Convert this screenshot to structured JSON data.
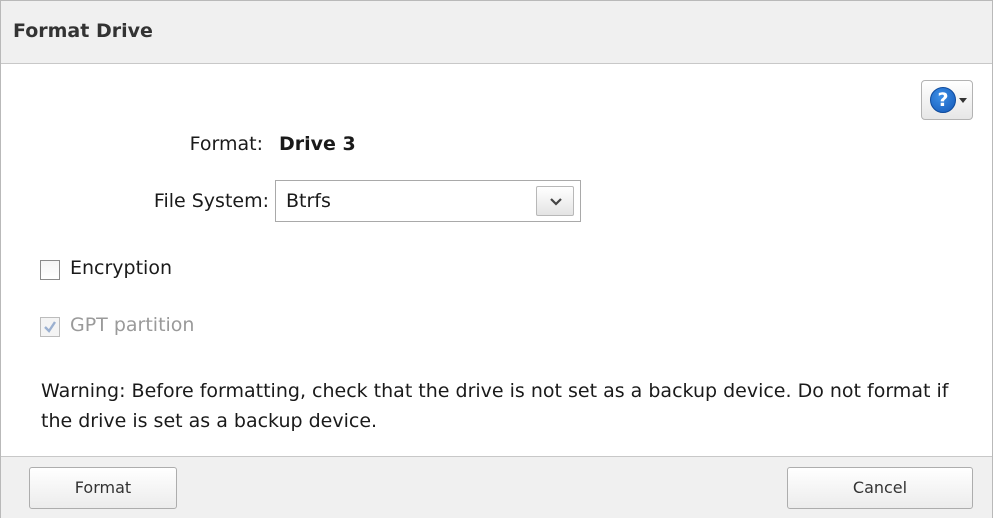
{
  "dialog": {
    "title": "Format Drive"
  },
  "help": {
    "icon": "help-icon",
    "glyph": "?"
  },
  "form": {
    "format_label": "Format:",
    "format_value": "Drive 3",
    "filesystem_label": "File System:",
    "filesystem_selected": "Btrfs",
    "encryption": {
      "label": "Encryption",
      "checked": false
    },
    "gpt": {
      "label": "GPT partition",
      "checked": true,
      "disabled": true
    }
  },
  "warning": "Warning: Before formatting, check that the drive is not set as a backup device. Do not format if the drive is set as a backup device.",
  "buttons": {
    "format": "Format",
    "cancel": "Cancel"
  }
}
